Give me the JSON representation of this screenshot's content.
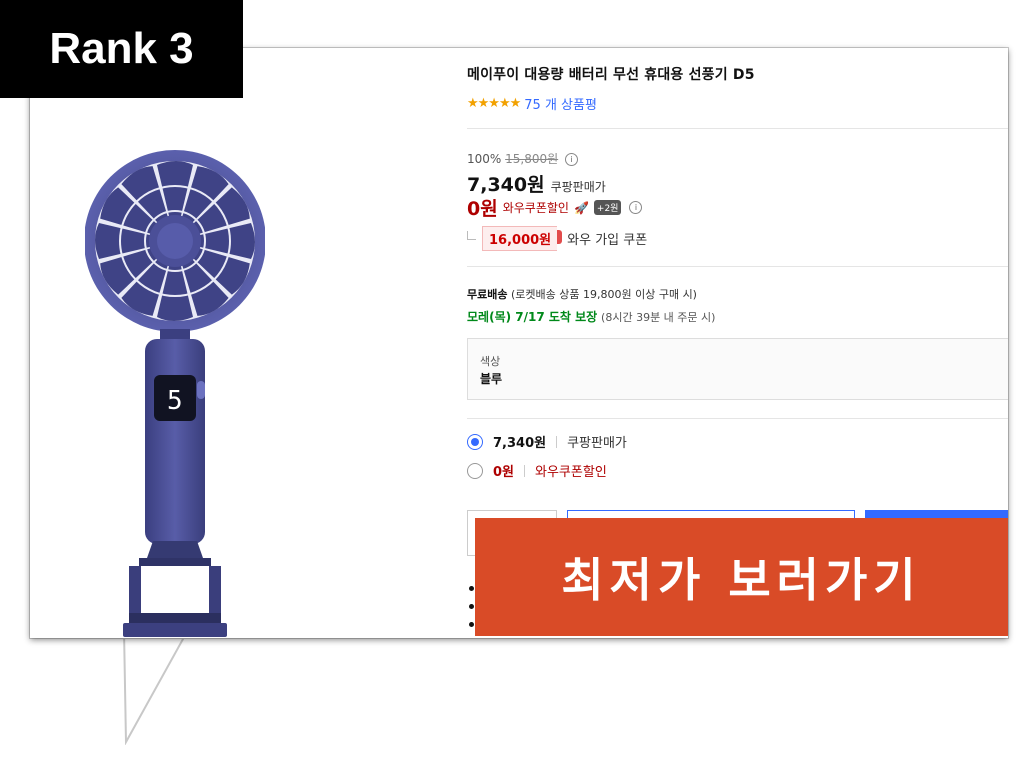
{
  "rank_badge": "Rank 3",
  "product": {
    "title": "메이푸이 대용량 배터리 무선 휴대용 선풍기 D5",
    "rating_stars": 4.5,
    "review_text": "75 개 상품평",
    "display_digit": "5"
  },
  "pricing": {
    "discount_rate": "100%",
    "original_price": "15,800원",
    "price": "7,340원",
    "price_label": "쿠팡판매가",
    "coupon_price": "0원",
    "coupon_label": "와우쿠폰할인",
    "coupon_badge": "+2원",
    "wow_coupon_amount": "16,000원",
    "wow_coupon_label": "와우 가입 쿠폰"
  },
  "shipping": {
    "free_label": "무료배송",
    "free_condition": "(로켓배송 상품 19,800원 이상 구매 시)",
    "arrival": "모레(목) 7/17 도착 보장",
    "arrival_note": "(8시간 39분 내 주문 시)"
  },
  "option": {
    "label": "색상",
    "value": "블루"
  },
  "price_options": [
    {
      "price": "7,340원",
      "label": "쿠팡판매가",
      "selected": true
    },
    {
      "price": "0원",
      "label": "와우쿠폰할인",
      "selected": false
    }
  ],
  "cta": {
    "label": "최저가 보러가기",
    "color": "#d94b27"
  },
  "colors": {
    "accent_blue": "#346aff",
    "price_red": "#ae0000",
    "delivery_green": "#00891a",
    "product_purple": "#4a4f9a"
  }
}
